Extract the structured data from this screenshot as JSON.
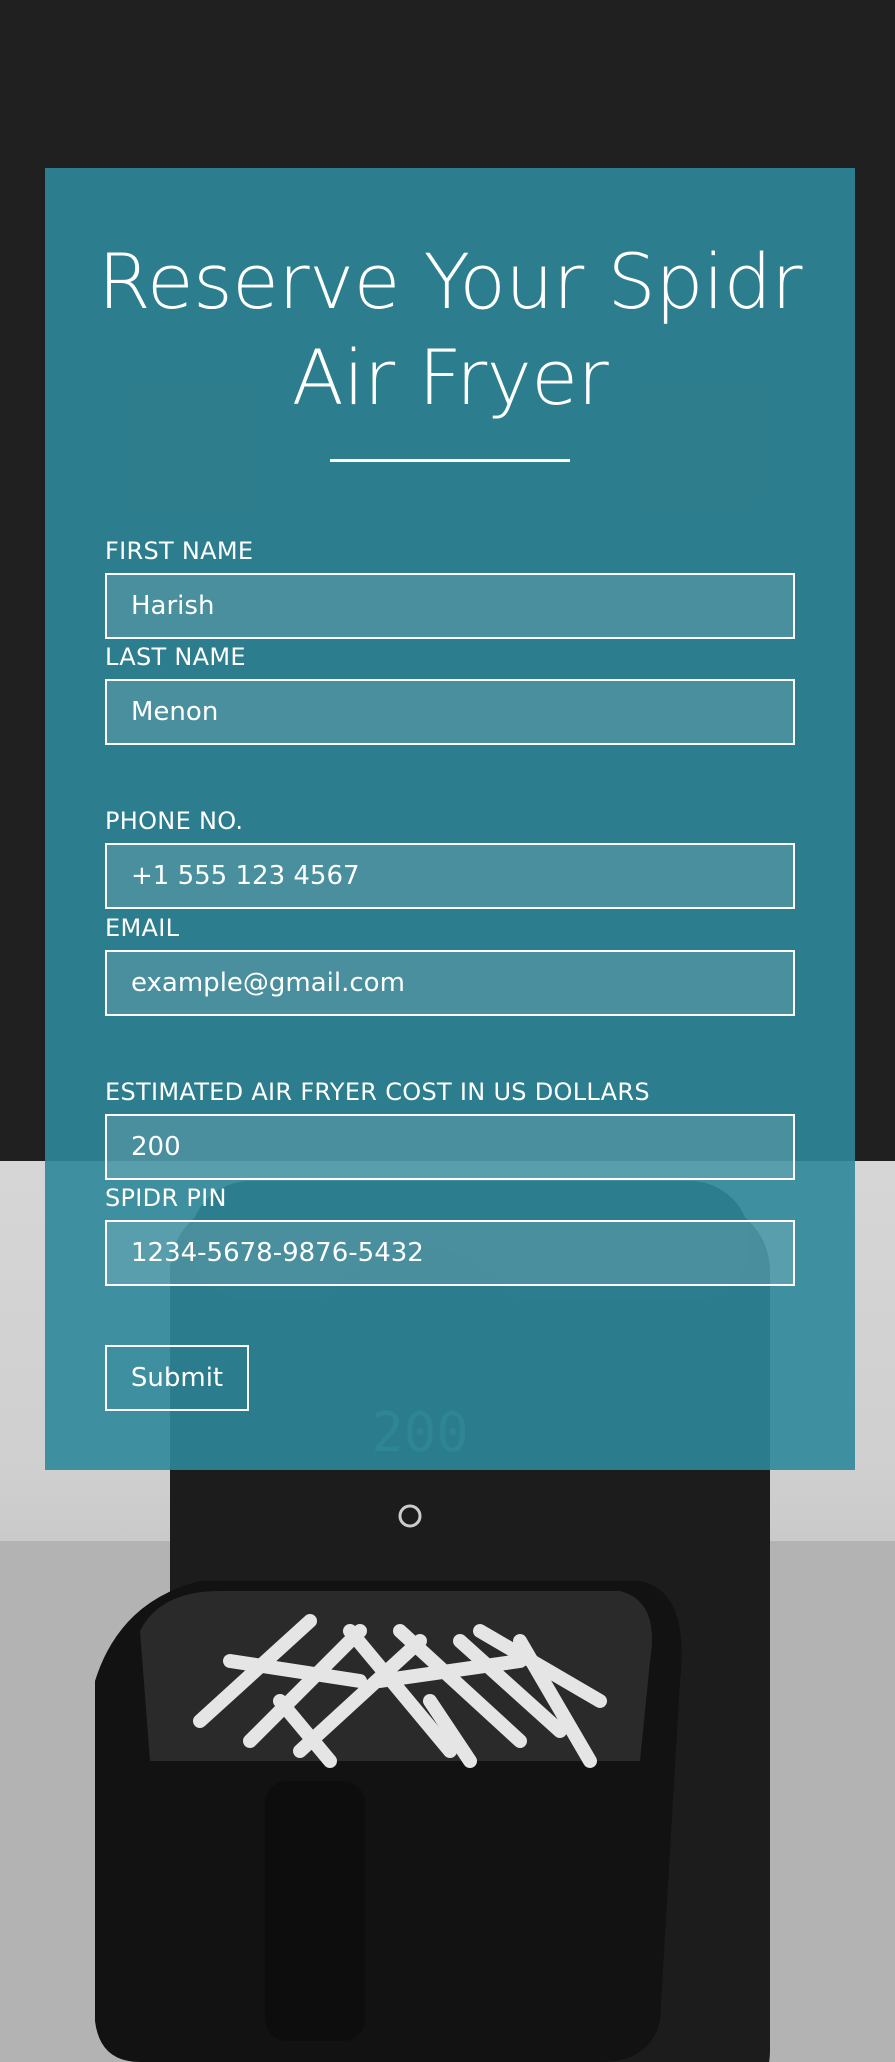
{
  "form": {
    "title": "Reserve Your Spidr Air Fryer",
    "fields": {
      "first_name": {
        "label": "FIRST NAME",
        "value": "Harish"
      },
      "last_name": {
        "label": "LAST NAME",
        "value": "Menon"
      },
      "phone": {
        "label": "PHONE NO.",
        "value": "+1 555 123 4567"
      },
      "email": {
        "label": "EMAIL",
        "value": "example@gmail.com"
      },
      "cost": {
        "label": "ESTIMATED AIR FRYER COST IN US DOLLARS",
        "value": "200"
      },
      "pin": {
        "label": "SPIDR PIN",
        "value": "1234-5678-9876-5432"
      }
    },
    "submit_label": "Submit"
  },
  "background": {
    "display_reading": "200"
  },
  "colors": {
    "page_background": "#202020",
    "card_teal": "#2e8799",
    "text": "#ffffff"
  }
}
